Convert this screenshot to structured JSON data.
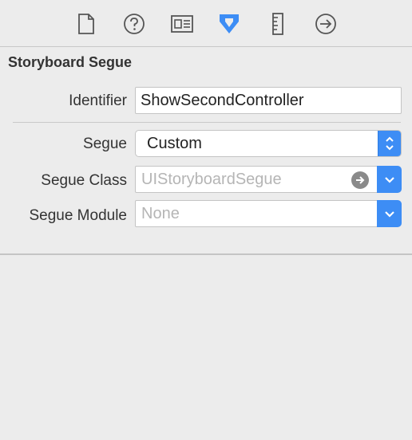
{
  "toolbar": {
    "icons": [
      "file-icon",
      "help-icon",
      "identity-icon",
      "attributes-icon",
      "size-icon",
      "connections-icon"
    ],
    "selected": "attributes-icon",
    "accent_color": "#3d8df5"
  },
  "section": {
    "title": "Storyboard Segue"
  },
  "identifier": {
    "label": "Identifier",
    "value": "ShowSecondController"
  },
  "segue": {
    "label": "Segue",
    "value": "Custom"
  },
  "segue_class": {
    "label": "Segue Class",
    "placeholder": "UIStoryboardSegue"
  },
  "segue_module": {
    "label": "Segue Module",
    "placeholder": "None"
  }
}
